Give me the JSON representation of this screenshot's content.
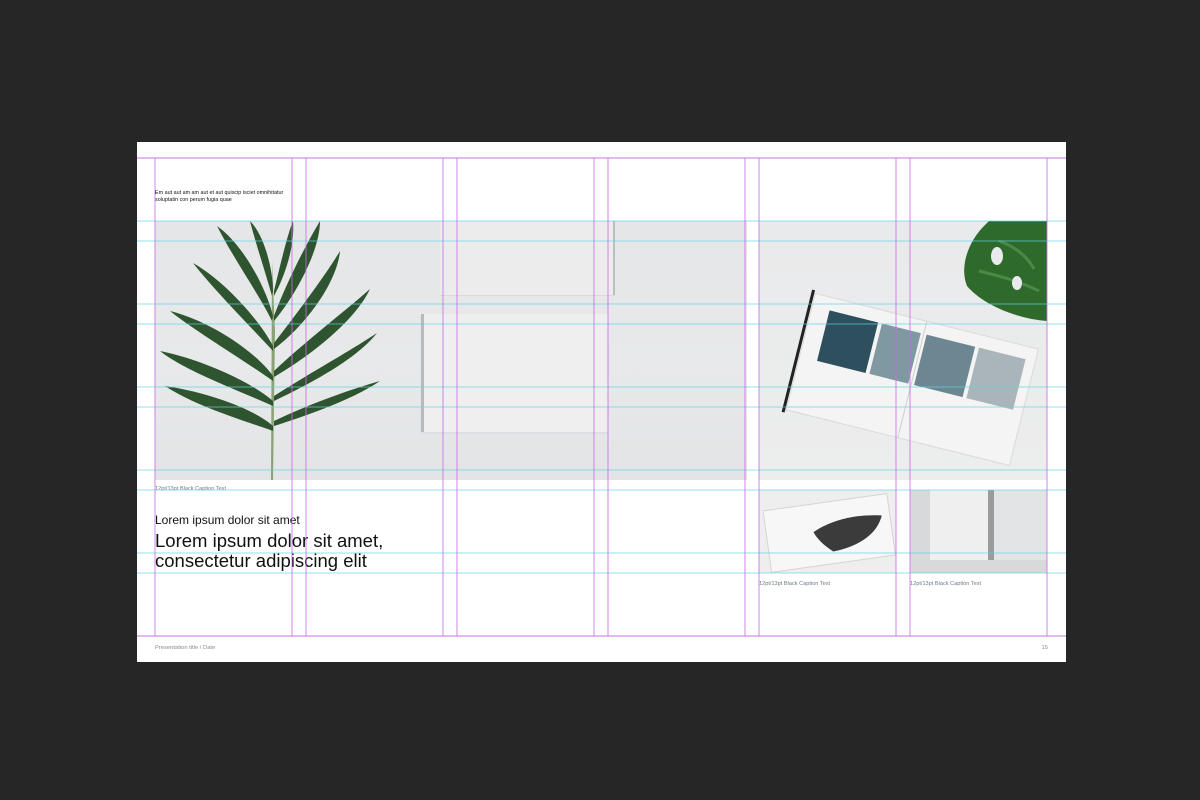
{
  "slide": {
    "intro_text": "Em aut aut am am aut et aut quiscip isciet omnihitatur soluptatin con perum fugia quae",
    "main_caption": "12pt/13pt Black Caption Text",
    "heading_small": "Lorem ipsum dolor sit amet",
    "heading_large": "Lorem ipsum dolor sit amet, consectetur adipiscing elit",
    "thumb_caption_a": "12pt/13pt Black Caption Text",
    "thumb_caption_b": "12pt/13pt Black Caption Text",
    "footer_title": "Presentation title  /  Date",
    "page_number": "15"
  },
  "images": {
    "main_photo": "palm-leaf-and-blank-cards-photo",
    "right_photo": "open-magazine-and-monstera-photo",
    "thumb_a": "magazine-cover-photo",
    "thumb_b": "folded-booklet-photo"
  },
  "colors": {
    "background": "#262626",
    "slide": "#ffffff",
    "guide_vertical": "#c86be0",
    "guide_horizontal": "#5fd3e6",
    "caption": "#6e7c87"
  }
}
